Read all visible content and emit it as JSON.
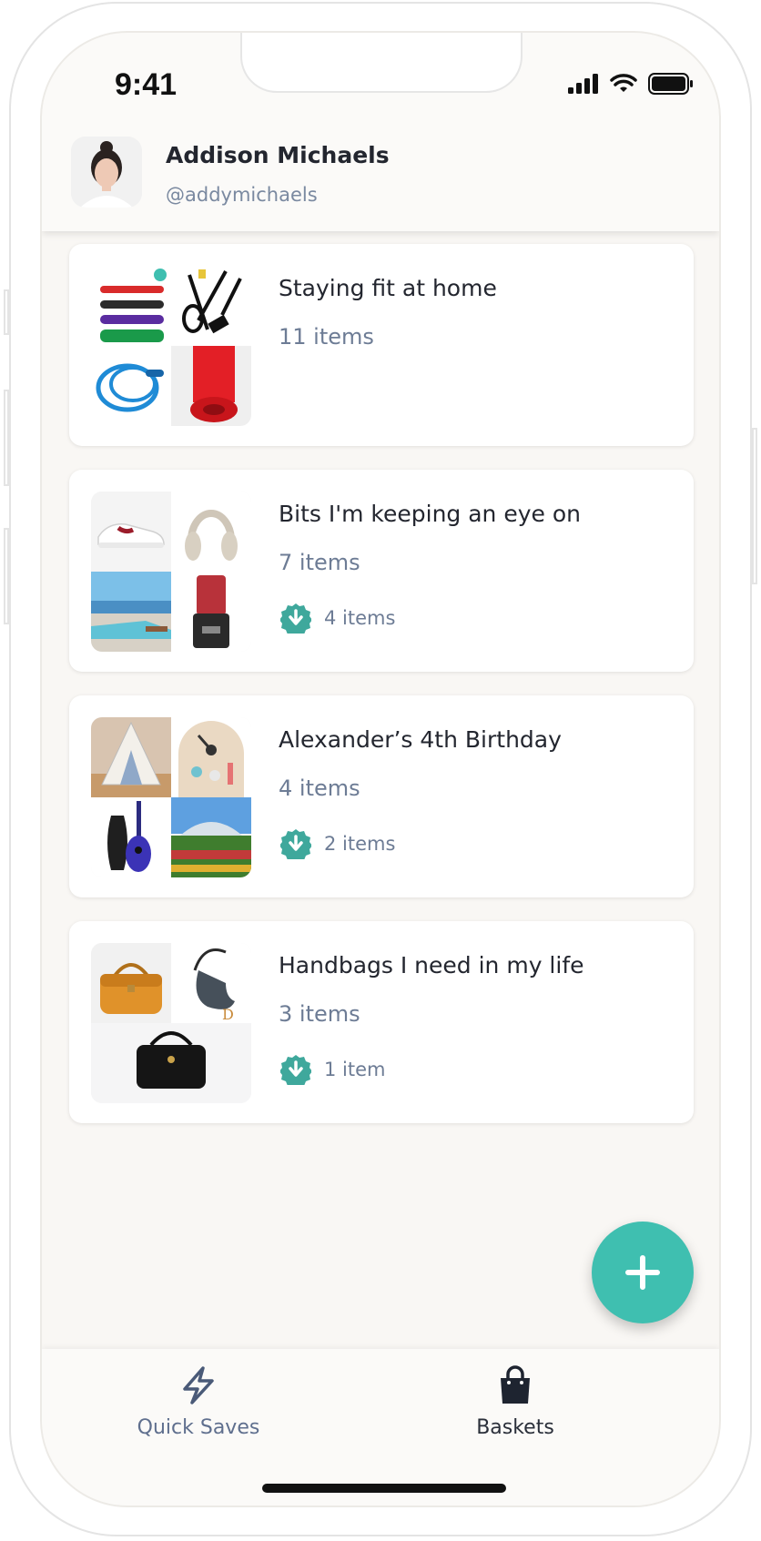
{
  "status_bar": {
    "time": "9:41",
    "icons": [
      "cellular-signal-icon",
      "wifi-icon",
      "battery-icon"
    ]
  },
  "profile": {
    "name": "Addison Michaels",
    "handle": "@addymichaels"
  },
  "baskets": [
    {
      "title": "Staying fit at home",
      "count": "11 items",
      "thumbnails": [
        "resistance-bands",
        "suspension-trainer",
        "jump-rope",
        "yoga-mat"
      ]
    },
    {
      "title": "Bits I'm keeping an eye on",
      "count": "7 items",
      "purchased": "4 items",
      "thumbnails": [
        "sneakers",
        "headphones",
        "pool-view",
        "blender"
      ]
    },
    {
      "title": "Alexander’s 4th Birthday",
      "count": "4 items",
      "purchased": "2 items",
      "thumbnails": [
        "play-tent",
        "weather-board",
        "guitar",
        "garden-greenhouse"
      ]
    },
    {
      "title": "Handbags I need in my life",
      "count": "3 items",
      "purchased": "1 item",
      "thumbnails": [
        "tan-satchel",
        "saddle-bag",
        "black-handbag"
      ]
    }
  ],
  "fab": {
    "icon": "plus-icon"
  },
  "tabs": [
    {
      "label": "Quick Saves",
      "icon": "lightning-icon",
      "active": false
    },
    {
      "label": "Baskets",
      "icon": "shopping-bag-icon",
      "active": true
    }
  ],
  "colors": {
    "accent": "#3fbfb0",
    "muted_text": "#6d7c95",
    "primary_text": "#23262f",
    "background": "#f9f7f4"
  }
}
